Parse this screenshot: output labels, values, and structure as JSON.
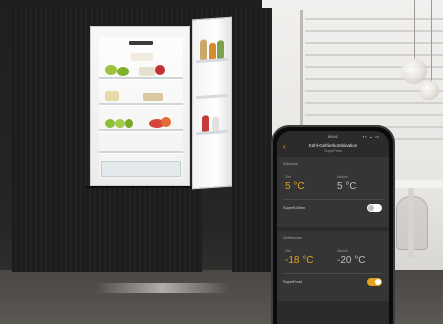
{
  "app": {
    "status_time": "09:41",
    "status_icons": "▪▪ ◒ ▭",
    "back_icon": "chevron-left-icon",
    "back_symbol": "‹",
    "title": "Kühl-Gefrierkombination",
    "subtitle": "SuperFrost"
  },
  "fridge_section": {
    "label": "Kühlzone",
    "target_label": "Ziel",
    "target_value": "5 °C",
    "current_label": "Aktuell",
    "current_value": "5 °C",
    "toggle_label": "SuperKühlen",
    "toggle_on": false
  },
  "freezer_section": {
    "label": "Gefrierzone",
    "target_label": "Ziel",
    "target_value": "-18 °C",
    "current_label": "Aktuell",
    "current_value": "-20 °C",
    "toggle_label": "SuperFrost",
    "toggle_on": true
  },
  "colors": {
    "accent": "#e0a31a",
    "toggle_off": "#ffffff",
    "toggle_on": "#e0a31a",
    "screen_bg": "#2b2b2b"
  }
}
